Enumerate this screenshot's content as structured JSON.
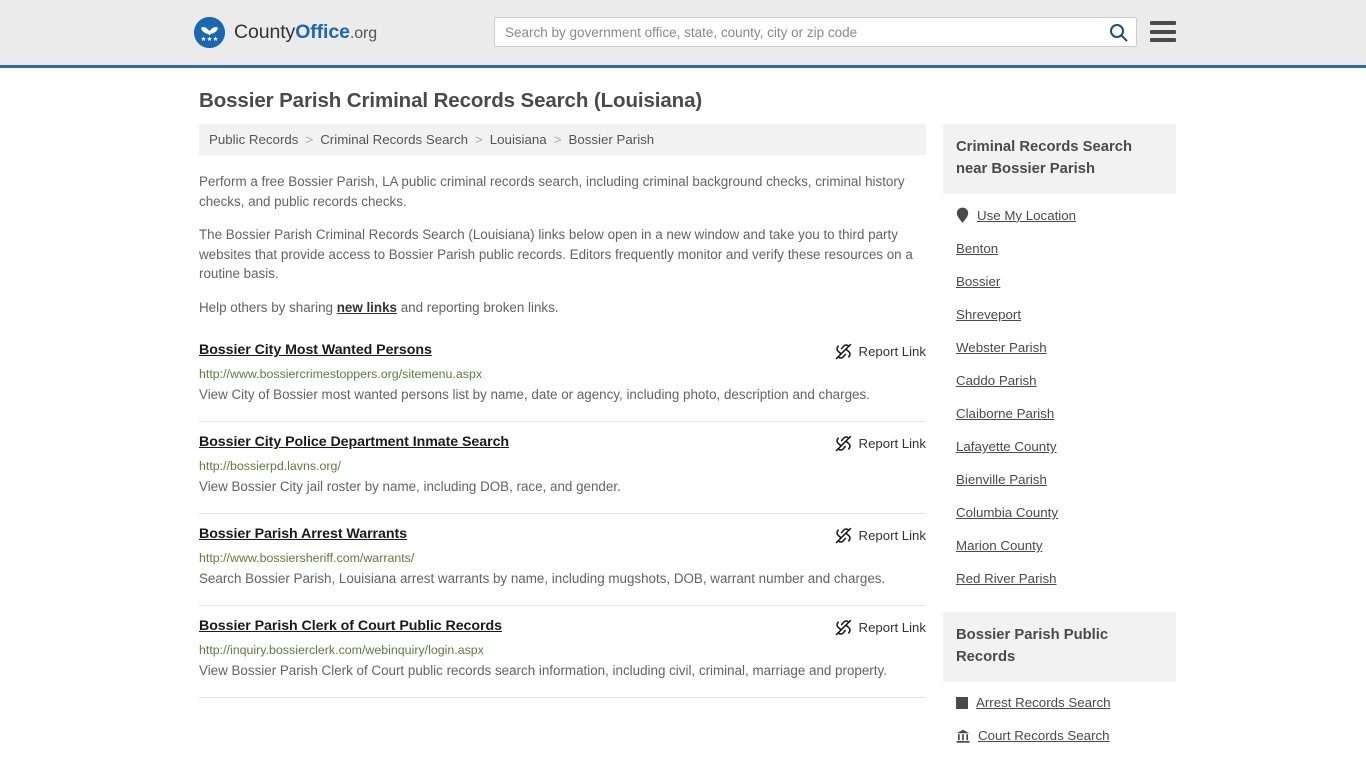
{
  "header": {
    "brand": {
      "part1": "County",
      "part2": "Office",
      "part3": ".org",
      "logo_icon": "eagle-stars-logo-icon"
    },
    "search": {
      "placeholder": "Search by government office, state, county, city or zip code",
      "value": "",
      "search_icon": "search-icon"
    },
    "menu_icon": "hamburger-menu-icon",
    "accent_color": "#2e6da4",
    "background_color": "#ebebeb"
  },
  "main": {
    "page_title": "Bossier Parish Criminal Records Search (Louisiana)",
    "breadcrumb": [
      {
        "label": "Public Records"
      },
      {
        "label": "Criminal Records Search"
      },
      {
        "label": "Louisiana"
      },
      {
        "label": "Bossier Parish"
      }
    ],
    "breadcrumb_separator": ">",
    "intro": {
      "p1": "Perform a free Bossier Parish, LA public criminal records search, including criminal background checks, criminal history checks, and public records checks.",
      "p2": "The Bossier Parish Criminal Records Search (Louisiana) links below open in a new window and take you to third party websites that provide access to Bossier Parish public records. Editors frequently monitor and verify these resources on a routine basis.",
      "p3_before": "Help others by sharing ",
      "p3_link": "new links",
      "p3_after": " and reporting broken links."
    },
    "report_link_label": "Report Link",
    "report_link_icon": "broken-link-icon",
    "results": [
      {
        "title": "Bossier City Most Wanted Persons",
        "url": "http://www.bossiercrimestoppers.org/sitemenu.aspx",
        "description": "View City of Bossier most wanted persons list by name, date or agency, including photo, description and charges."
      },
      {
        "title": "Bossier City Police Department Inmate Search",
        "url": "http://bossierpd.lavns.org/",
        "description": "View Bossier City jail roster by name, including DOB, race, and gender."
      },
      {
        "title": "Bossier Parish Arrest Warrants",
        "url": "http://www.bossiersheriff.com/warrants/",
        "description": "Search Bossier Parish, Louisiana arrest warrants by name, including mugshots, DOB, warrant number and charges."
      },
      {
        "title": "Bossier Parish Clerk of Court Public Records",
        "url": "http://inquiry.bossierclerk.com/webinquiry/login.aspx",
        "description": "View Bossier Parish Clerk of Court public records search information, including civil, criminal, marriage and property."
      }
    ]
  },
  "sidebar": {
    "nearby": {
      "heading": "Criminal Records Search near Bossier Parish",
      "items": [
        {
          "label": "Use My Location",
          "icon": "map-pin-icon"
        },
        {
          "label": "Benton",
          "icon": ""
        },
        {
          "label": "Bossier",
          "icon": ""
        },
        {
          "label": "Shreveport",
          "icon": ""
        },
        {
          "label": "Webster Parish",
          "icon": ""
        },
        {
          "label": "Caddo Parish",
          "icon": ""
        },
        {
          "label": "Claiborne Parish",
          "icon": ""
        },
        {
          "label": "Lafayette County",
          "icon": ""
        },
        {
          "label": "Bienville Parish",
          "icon": ""
        },
        {
          "label": "Columbia County",
          "icon": ""
        },
        {
          "label": "Marion County",
          "icon": ""
        },
        {
          "label": "Red River Parish",
          "icon": ""
        }
      ]
    },
    "public_records": {
      "heading": "Bossier Parish Public Records",
      "items": [
        {
          "label": "Arrest Records Search",
          "icon": "square-icon"
        },
        {
          "label": "Court Records Search",
          "icon": "courthouse-icon"
        }
      ]
    }
  }
}
